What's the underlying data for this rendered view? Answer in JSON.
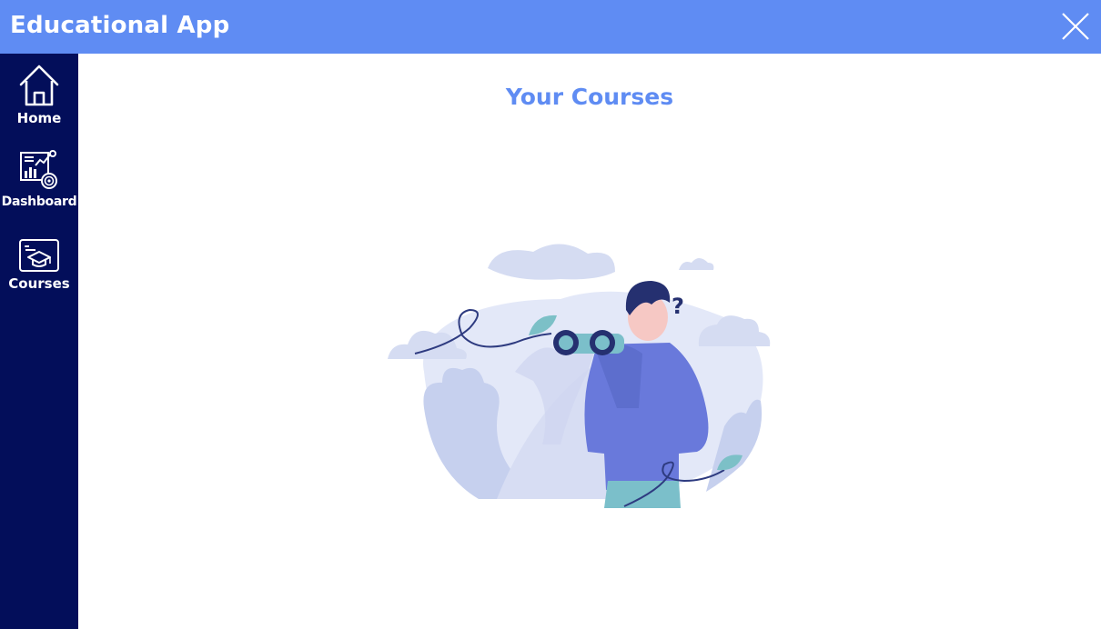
{
  "app": {
    "title": "Educational App"
  },
  "window": {
    "close_icon": "close-icon"
  },
  "sidebar": {
    "items": [
      {
        "label": "Home",
        "icon": "home-icon"
      },
      {
        "label": "Dashboard",
        "icon": "dashboard-icon"
      },
      {
        "label": "Courses",
        "icon": "courses-icon"
      }
    ]
  },
  "main": {
    "title": "Your Courses",
    "illustration": "person-with-binoculars-illustration"
  },
  "colors": {
    "header": "#5f8cf3",
    "sidebar": "#030e5a",
    "title": "#5f8cf3",
    "illustration_blob": "#e3e8f8",
    "illustration_person": "#6979db"
  }
}
